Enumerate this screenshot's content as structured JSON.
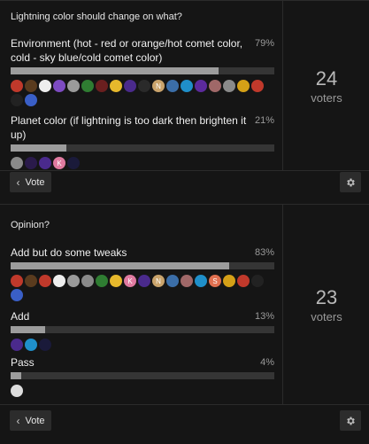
{
  "polls": [
    {
      "title": "Lightning color should change on what?",
      "voters_count": "24",
      "voters_label": "voters",
      "options": [
        {
          "label": "Environment (hot - red or orange/hot comet color, cold - sky blue/cold comet color)",
          "percent_text": "79%",
          "percent": 79,
          "avatars": [
            {
              "icon": "fire-avatar",
              "color": "#c0392b",
              "letter": ""
            },
            {
              "icon": "figure-avatar",
              "color": "#5a3b1e",
              "letter": ""
            },
            {
              "icon": "yin-yang-avatar",
              "color": "#eeeeee",
              "letter": ""
            },
            {
              "icon": "pixel-avatar",
              "color": "#7d4bc2",
              "letter": ""
            },
            {
              "icon": "ghost-avatar",
              "color": "#9a9a9a",
              "letter": ""
            },
            {
              "icon": "creature-avatar",
              "color": "#2f7d32",
              "letter": ""
            },
            {
              "icon": "dark-avatar",
              "color": "#6a1f1f",
              "letter": ""
            },
            {
              "icon": "face-avatar",
              "color": "#e6b82c",
              "letter": ""
            },
            {
              "icon": "spark-avatar",
              "color": "#4a2a8c",
              "letter": ""
            },
            {
              "icon": "plain-avatar",
              "color": "#2a2a2a",
              "letter": ""
            },
            {
              "icon": "letter-n-avatar",
              "color": "#c9a36b",
              "letter": "N"
            },
            {
              "icon": "eye-avatar",
              "color": "#3b6ea8",
              "letter": ""
            },
            {
              "icon": "round-avatar",
              "color": "#1f8fc9",
              "letter": ""
            },
            {
              "icon": "purple-avatar",
              "color": "#5c2a9c",
              "letter": ""
            },
            {
              "icon": "anime-avatar",
              "color": "#a06868",
              "letter": ""
            },
            {
              "icon": "portrait-avatar",
              "color": "#8a8a8a",
              "letter": ""
            },
            {
              "icon": "star-avatar",
              "color": "#d4a017",
              "letter": ""
            },
            {
              "icon": "bolt-avatar",
              "color": "#c0392b",
              "letter": ""
            },
            {
              "icon": "shadow-avatar",
              "color": "#222222",
              "letter": ""
            },
            {
              "icon": "robot-avatar",
              "color": "#3a5fc7",
              "letter": ""
            }
          ]
        },
        {
          "label": "Planet color (if lightning is too dark then brighten it up)",
          "percent_text": "21%",
          "percent": 21,
          "avatars": [
            {
              "icon": "portrait-avatar",
              "color": "#8a8a8a",
              "letter": ""
            },
            {
              "icon": "shadow-avatar",
              "color": "#2a1a4a",
              "letter": ""
            },
            {
              "icon": "spark-avatar",
              "color": "#4a2a8c",
              "letter": ""
            },
            {
              "icon": "letter-k-avatar",
              "color": "#e07aa0",
              "letter": "K"
            },
            {
              "icon": "dark-avatar",
              "color": "#1a1a3a",
              "letter": ""
            }
          ]
        }
      ],
      "vote_label": "Vote"
    },
    {
      "title": "Opinion?",
      "voters_count": "23",
      "voters_label": "voters",
      "options": [
        {
          "label": "Add but do some tweaks",
          "percent_text": "83%",
          "percent": 83,
          "avatars": [
            {
              "icon": "fire-avatar",
              "color": "#c0392b",
              "letter": ""
            },
            {
              "icon": "figure-avatar",
              "color": "#5a3b1e",
              "letter": ""
            },
            {
              "icon": "fire-avatar",
              "color": "#c0392b",
              "letter": ""
            },
            {
              "icon": "yin-yang-avatar",
              "color": "#eeeeee",
              "letter": ""
            },
            {
              "icon": "ghost-avatar",
              "color": "#9a9a9a",
              "letter": ""
            },
            {
              "icon": "portrait-avatar",
              "color": "#8a8a8a",
              "letter": ""
            },
            {
              "icon": "creature-avatar",
              "color": "#2f7d32",
              "letter": ""
            },
            {
              "icon": "face-avatar",
              "color": "#e6b82c",
              "letter": ""
            },
            {
              "icon": "letter-k-avatar",
              "color": "#e07aa0",
              "letter": "K"
            },
            {
              "icon": "spark-avatar",
              "color": "#4a2a8c",
              "letter": ""
            },
            {
              "icon": "letter-n-avatar",
              "color": "#c9a36b",
              "letter": "N"
            },
            {
              "icon": "eye-avatar",
              "color": "#3b6ea8",
              "letter": ""
            },
            {
              "icon": "anime-avatar",
              "color": "#a06868",
              "letter": ""
            },
            {
              "icon": "round-avatar",
              "color": "#1f8fc9",
              "letter": ""
            },
            {
              "icon": "letter-s-avatar",
              "color": "#e07050",
              "letter": "S"
            },
            {
              "icon": "star-avatar",
              "color": "#d4a017",
              "letter": ""
            },
            {
              "icon": "bolt-avatar",
              "color": "#c0392b",
              "letter": ""
            },
            {
              "icon": "shadow-avatar",
              "color": "#222222",
              "letter": ""
            },
            {
              "icon": "robot-avatar",
              "color": "#3a5fc7",
              "letter": ""
            }
          ]
        },
        {
          "label": "Add",
          "percent_text": "13%",
          "percent": 13,
          "avatars": [
            {
              "icon": "spark-avatar",
              "color": "#4a2a8c",
              "letter": ""
            },
            {
              "icon": "round-avatar",
              "color": "#1f8fc9",
              "letter": ""
            },
            {
              "icon": "dark-avatar",
              "color": "#1a1a3a",
              "letter": ""
            }
          ]
        },
        {
          "label": "Pass",
          "percent_text": "4%",
          "percent": 4,
          "avatars": [
            {
              "icon": "face-avatar",
              "color": "#dddddd",
              "letter": ""
            }
          ]
        }
      ],
      "vote_label": "Vote"
    }
  ]
}
